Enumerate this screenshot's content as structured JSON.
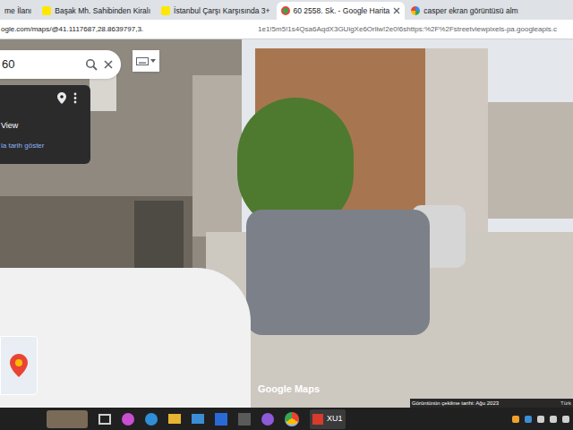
{
  "browser": {
    "tabs": [
      {
        "label": "me İlanı",
        "selected": false,
        "kind": "site"
      },
      {
        "label": "Başak Mh. Sahibinden Kiralı",
        "selected": false,
        "kind": "sahibinden"
      },
      {
        "label": "İstanbul Çarşı Karşısında 3+",
        "selected": false,
        "kind": "sahibinden"
      },
      {
        "label": "60 2558. Sk. - Google Harita",
        "selected": true,
        "kind": "maps"
      },
      {
        "label": "casper ekran görüntüsü alm",
        "selected": false,
        "kind": "google"
      }
    ],
    "url_left": "ogle.com/maps/@41.1117687,28.8639797,3.",
    "url_right": "1e1!5m5!1s4Qsa6AqdX3GUigXe6Orliw!2e0!6shttps:%2F%2Fstreetviewpixels-pa.googleapis.c"
  },
  "maps": {
    "search": {
      "value": "60"
    },
    "side_panel": {
      "title": "View",
      "link": "la tarih göster"
    },
    "brand": "Google Maps",
    "footer": {
      "capture_date": "Görüntünün çekilme tarihi: Ağu 2023",
      "extra": "Türk"
    }
  },
  "taskbar": {
    "app_label": "XU1"
  }
}
